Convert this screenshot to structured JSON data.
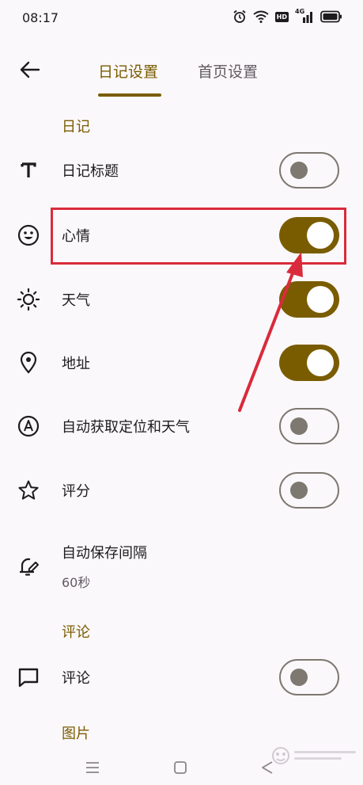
{
  "status_bar": {
    "time": "08:17",
    "icons": [
      "alarm-icon",
      "wifi-icon",
      "hd-badge",
      "4g-signal-icon",
      "battery-icon"
    ],
    "hd_label": "HD",
    "network_label": "4G"
  },
  "header": {
    "back_icon": "arrow-left-icon",
    "tabs": [
      {
        "label": "日记设置",
        "active": true
      },
      {
        "label": "首页设置",
        "active": false
      }
    ]
  },
  "sections": {
    "diary": {
      "header": "日记",
      "items": [
        {
          "icon": "text-t-icon",
          "label": "日记标题",
          "toggle": false
        },
        {
          "icon": "smiley-icon",
          "label": "心情",
          "toggle": true
        },
        {
          "icon": "sun-icon",
          "label": "天气",
          "toggle": true
        },
        {
          "icon": "location-pin-icon",
          "label": "地址",
          "toggle": true
        },
        {
          "icon": "circle-a-icon",
          "label": "自动获取定位和天气",
          "toggle": false
        },
        {
          "icon": "star-icon",
          "label": "评分",
          "toggle": false
        }
      ],
      "autosave": {
        "icon": "bell-edit-icon",
        "label": "自动保存间隔",
        "value": "60秒"
      }
    },
    "comments": {
      "header": "评论",
      "items": [
        {
          "icon": "comment-bubble-icon",
          "label": "评论",
          "toggle": false
        }
      ]
    },
    "images": {
      "header": "图片"
    }
  },
  "colors": {
    "accent": "#7a5c00",
    "switch_off": "#7d7870",
    "highlight": "#d92b3b",
    "background": "#fbf8fb"
  },
  "nav_bar": {
    "icons": [
      "menu-icon",
      "home-square-icon",
      "back-triangle-icon"
    ]
  }
}
